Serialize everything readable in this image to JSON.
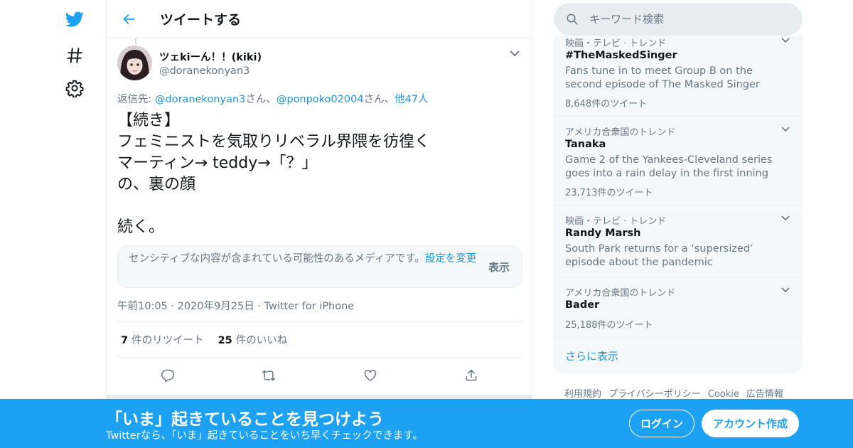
{
  "colors": {
    "accent": "#1da1f2",
    "link": "#1b95e0",
    "secondary_text": "#657786",
    "primary_text": "#14171a",
    "border": "#e6ecf0",
    "panel_bg": "#f5f8fa"
  },
  "leftnav": {
    "icons": [
      "twitter-bird-icon",
      "hashtag-icon",
      "gear-icon"
    ]
  },
  "header": {
    "back_icon": "arrow-left-icon",
    "title": "ツイートする"
  },
  "tweet": {
    "display_name": "ツェkiーん！！(kiki)",
    "handle": "@doranekonyan3",
    "reply_prefix": "返信先: ",
    "reply_user1": "@doranekonyan3",
    "reply_sep1": "さん、",
    "reply_user2": "@ponpoko02004",
    "reply_sep2": "さん、",
    "reply_others": "他47人",
    "text": "【続き】\nフェミニストを気取りリベラル界隈を彷徨く\nマーティン→ teddy→「？」\nの、裏の顔\n\n続く。",
    "sensitive_notice": "センシティブな内容が含まれている可能性のあるメディアです。",
    "sensitive_settings_link": "設定を変更",
    "sensitive_show": "表示",
    "time": "午前10:05",
    "date": "2020年9月25日",
    "source": "Twitter for iPhone",
    "retweet_count": "7",
    "retweet_label": "件のリツイート",
    "like_count": "25",
    "like_label": "件のいいね"
  },
  "search": {
    "placeholder": "キーワード検索"
  },
  "trends": [
    {
      "context": "映画・テレビ · トレンド",
      "name": "#TheMaskedSinger",
      "description": "Fans tune in to meet Group B on the second episode of The Masked Singer",
      "count": "8,648件のツイート"
    },
    {
      "context": "アメリカ合衆国のトレンド",
      "name": "Tanaka",
      "description": "Game 2 of the Yankees-Cleveland series goes into a rain delay in the first inning",
      "count": "23,713件のツイート"
    },
    {
      "context": "映画・テレビ · トレンド",
      "name": "Randy Marsh",
      "description": "South Park returns for a ‘supersized’ episode about the pandemic",
      "count": ""
    },
    {
      "context": "アメリカ合衆国のトレンド",
      "name": "Bader",
      "description": "",
      "count": "25,188件のツイート"
    }
  ],
  "show_more": "さらに表示",
  "footer_links": [
    "利用規約",
    "プライバシーポリシー",
    "Cookie",
    "広告情報"
  ],
  "bottom_bar": {
    "title": "「いま」起きていることを見つけよう",
    "subtitle": "Twitterなら、「いま」起きていることをいち早くチェックできます。",
    "login": "ログイン",
    "signup": "アカウント作成"
  }
}
